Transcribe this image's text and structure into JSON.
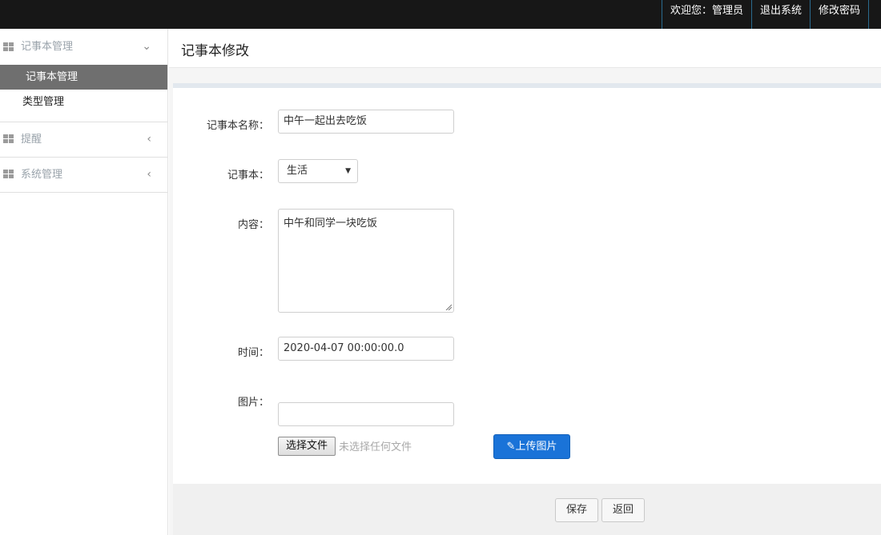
{
  "topbar": {
    "welcome": "欢迎您：管理员",
    "logout": "退出系统",
    "change_password": "修改密码"
  },
  "sidebar": {
    "groups": [
      {
        "label": "记事本管理",
        "chevron": "⌄",
        "items": [
          {
            "label": "记事本管理"
          },
          {
            "label": "类型管理"
          }
        ]
      },
      {
        "label": "提醒",
        "chevron": "‹"
      },
      {
        "label": "系统管理",
        "chevron": "‹"
      }
    ]
  },
  "page": {
    "title": "记事本修改"
  },
  "form": {
    "name": {
      "label": "记事本名称：",
      "value": "中午一起出去吃饭"
    },
    "notebook": {
      "label": "记事本：",
      "value": "生活"
    },
    "content": {
      "label": "内容：",
      "value": "中午和同学一块吃饭"
    },
    "time": {
      "label": "时间：",
      "value": "2020-04-07 00:00:00.0"
    },
    "image": {
      "label": "图片：",
      "value": "",
      "choose_file": "选择文件",
      "no_file": "未选择任何文件",
      "upload": "上传图片"
    }
  },
  "actions": {
    "save": "保存",
    "back": "返回"
  }
}
